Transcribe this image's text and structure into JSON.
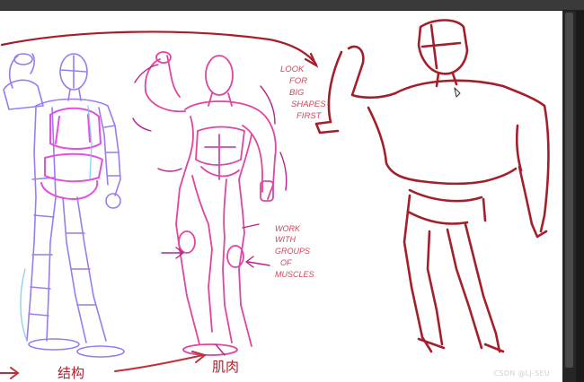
{
  "canvas": {
    "background": "#ffffff",
    "annotations": {
      "shapes_lines": [
        "LOOK",
        "FOR",
        "BIG",
        "SHAPES",
        "FIRST"
      ],
      "muscles_lines": [
        "WORK",
        "WITH",
        "GROUPS",
        "OF",
        "MUSCLES"
      ],
      "bottom_left": "结构",
      "bottom_right": "肌肉"
    },
    "colors": {
      "wireframe": "#9b7cf0",
      "wireframe_accent": "#e44fe0",
      "muscle": "#e0459f",
      "silhouette": "#a51e2b",
      "note": "#d2455a"
    }
  },
  "watermark": "CSDN @LJ-SEU"
}
